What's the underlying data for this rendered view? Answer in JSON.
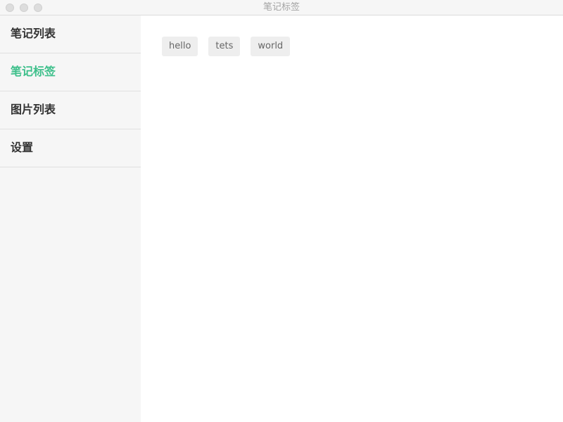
{
  "window": {
    "title": "笔记标签"
  },
  "sidebar": {
    "items": [
      {
        "label": "笔记列表",
        "active": false
      },
      {
        "label": "笔记标签",
        "active": true
      },
      {
        "label": "图片列表",
        "active": false
      },
      {
        "label": "设置",
        "active": false
      }
    ]
  },
  "main": {
    "tags": [
      {
        "label": "hello"
      },
      {
        "label": "tets"
      },
      {
        "label": "world"
      }
    ]
  },
  "colors": {
    "active": "#3cbf8a",
    "sidebar_bg": "#f6f6f6",
    "tag_bg": "#eeeeee"
  }
}
